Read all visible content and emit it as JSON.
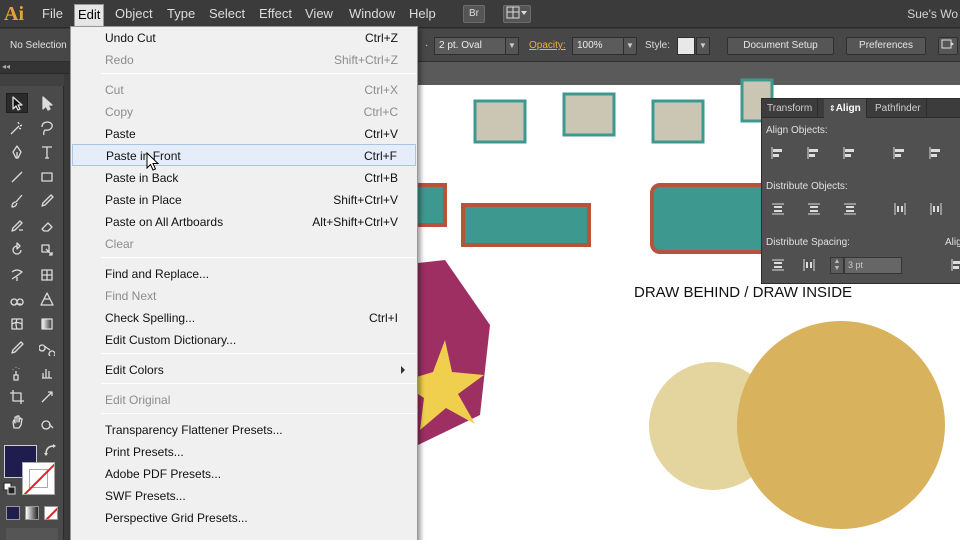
{
  "app": {
    "logo": "Ai",
    "workspace": "Sue's Wo"
  },
  "menubar": {
    "items": [
      {
        "label": "File"
      },
      {
        "label": "Edit"
      },
      {
        "label": "Object"
      },
      {
        "label": "Type"
      },
      {
        "label": "Select"
      },
      {
        "label": "Effect"
      },
      {
        "label": "View"
      },
      {
        "label": "Window"
      },
      {
        "label": "Help"
      }
    ],
    "bridge_button": "Br"
  },
  "controlbar": {
    "selection_status": "No Selection",
    "brush_value": "2 pt. Oval",
    "opacity_label": "Opacity:",
    "opacity_value": "100%",
    "style_label": "Style:",
    "document_setup": "Document Setup",
    "preferences": "Preferences"
  },
  "edit_menu": {
    "items": [
      {
        "label": "Undo Cut",
        "shortcut": "Ctrl+Z",
        "disabled": false
      },
      {
        "label": "Redo",
        "shortcut": "Shift+Ctrl+Z",
        "disabled": true
      },
      {
        "label": "Cut",
        "shortcut": "Ctrl+X",
        "disabled": true
      },
      {
        "label": "Copy",
        "shortcut": "Ctrl+C",
        "disabled": true
      },
      {
        "label": "Paste",
        "shortcut": "Ctrl+V",
        "disabled": false
      },
      {
        "label": "Paste in Front",
        "shortcut": "Ctrl+F",
        "disabled": false,
        "hover": true
      },
      {
        "label": "Paste in Back",
        "shortcut": "Ctrl+B",
        "disabled": false
      },
      {
        "label": "Paste in Place",
        "shortcut": "Shift+Ctrl+V",
        "disabled": false
      },
      {
        "label": "Paste on All Artboards",
        "shortcut": "Alt+Shift+Ctrl+V",
        "disabled": false
      },
      {
        "label": "Clear",
        "shortcut": "",
        "disabled": true
      },
      {
        "label": "Find and Replace...",
        "shortcut": "",
        "disabled": false
      },
      {
        "label": "Find Next",
        "shortcut": "",
        "disabled": true
      },
      {
        "label": "Check Spelling...",
        "shortcut": "Ctrl+I",
        "disabled": false
      },
      {
        "label": "Edit Custom Dictionary...",
        "shortcut": "",
        "disabled": false
      },
      {
        "label": "Edit Colors",
        "shortcut": "",
        "disabled": false,
        "submenu": true
      },
      {
        "label": "Edit Original",
        "shortcut": "",
        "disabled": true
      },
      {
        "label": "Transparency Flattener Presets...",
        "shortcut": "",
        "disabled": false
      },
      {
        "label": "Print Presets...",
        "shortcut": "",
        "disabled": false
      },
      {
        "label": "Adobe PDF Presets...",
        "shortcut": "",
        "disabled": false
      },
      {
        "label": "SWF Presets...",
        "shortcut": "",
        "disabled": false
      },
      {
        "label": "Perspective Grid Presets...",
        "shortcut": "",
        "disabled": false
      }
    ]
  },
  "align_panel": {
    "tabs": [
      {
        "label": "Transform"
      },
      {
        "label": "Align"
      },
      {
        "label": "Pathfinder"
      }
    ],
    "align_objects_label": "Align Objects:",
    "distribute_objects_label": "Distribute Objects:",
    "distribute_spacing_label": "Distribute Spacing:",
    "align_to_label": "Alig",
    "spacing_value": "3 pt"
  },
  "artboard": {
    "caption": "DRAW BEHIND / DRAW INSIDE"
  },
  "colors": {
    "fill": "#1f1d4d",
    "teal": "#3d9990",
    "tan": "#cbc6b3",
    "brick": "#b5533e",
    "plum": "#9e2f62",
    "star": "#f0cf4f",
    "gold": "#d9b25d",
    "pale_gold": "#e3d59d"
  }
}
